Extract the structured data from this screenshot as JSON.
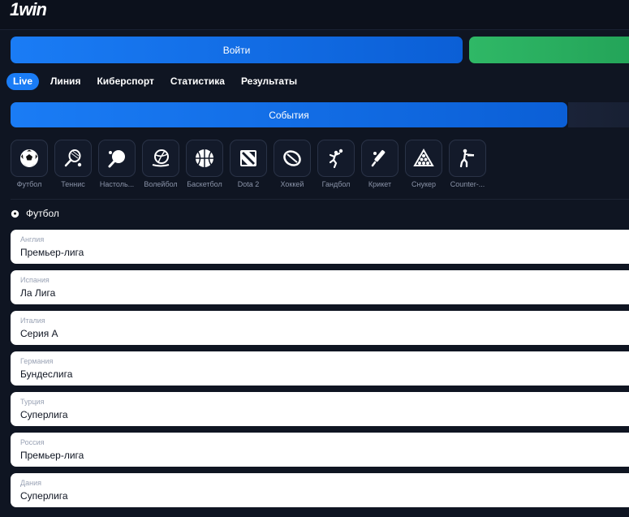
{
  "brand": {
    "logo": "1win"
  },
  "auth": {
    "login_label": "Войти"
  },
  "nav": {
    "tabs": [
      {
        "label": "Live",
        "active": true
      },
      {
        "label": "Линия",
        "active": false
      },
      {
        "label": "Киберспорт",
        "active": false
      },
      {
        "label": "Статистика",
        "active": false
      },
      {
        "label": "Результаты",
        "active": false
      }
    ]
  },
  "subnav": {
    "events_label": "События"
  },
  "sports": [
    {
      "label": "Футбол",
      "icon": "football-icon"
    },
    {
      "label": "Теннис",
      "icon": "tennis-icon"
    },
    {
      "label": "Настоль...",
      "icon": "table-tennis-icon"
    },
    {
      "label": "Волейбол",
      "icon": "volleyball-icon"
    },
    {
      "label": "Баскетбол",
      "icon": "basketball-icon"
    },
    {
      "label": "Dota 2",
      "icon": "dota2-icon"
    },
    {
      "label": "Хоккей",
      "icon": "hockey-icon"
    },
    {
      "label": "Гандбол",
      "icon": "handball-icon"
    },
    {
      "label": "Крикет",
      "icon": "cricket-icon"
    },
    {
      "label": "Снукер",
      "icon": "snooker-icon"
    },
    {
      "label": "Counter-...",
      "icon": "counter-strike-icon"
    }
  ],
  "section": {
    "title": "Футбол",
    "icon": "football-icon"
  },
  "leagues": [
    {
      "country": "Англия",
      "name": "Премьер-лига"
    },
    {
      "country": "Испания",
      "name": "Ла Лига"
    },
    {
      "country": "Италия",
      "name": "Серия А"
    },
    {
      "country": "Германия",
      "name": "Бундеслига"
    },
    {
      "country": "Турция",
      "name": "Суперлига"
    },
    {
      "country": "Россия",
      "name": "Премьер-лига"
    },
    {
      "country": "Дания",
      "name": "Суперлига"
    }
  ],
  "colors": {
    "accent": "#1a7cf5",
    "success": "#2fb866",
    "background": "#0f1522",
    "card": "#ffffff"
  }
}
